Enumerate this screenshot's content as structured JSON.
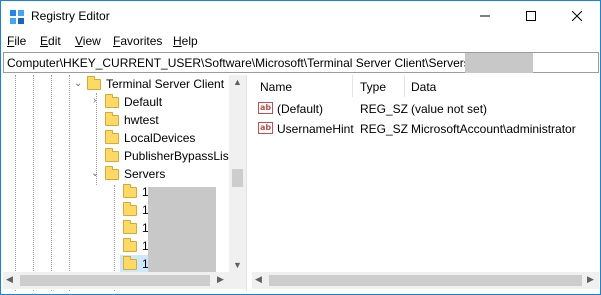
{
  "window": {
    "title": "Registry Editor",
    "icon": "registry-editor-icon"
  },
  "menu": [
    "File",
    "Edit",
    "View",
    "Favorites",
    "Help"
  ],
  "address": {
    "path": "Computer\\HKEY_CURRENT_USER\\Software\\Microsoft\\Terminal Server Client\\Servers\\"
  },
  "tree": {
    "items": [
      {
        "label": "Terminal Server Client",
        "expanded": true
      },
      {
        "label": "Default",
        "expanded": false
      },
      {
        "label": "hwtest"
      },
      {
        "label": "LocalDevices"
      },
      {
        "label": "PublisherBypassList"
      },
      {
        "label": "Servers",
        "expanded": true
      },
      {
        "label": "1"
      },
      {
        "label": "1"
      },
      {
        "label": "1"
      },
      {
        "label": "1"
      },
      {
        "label": "1",
        "selected": true
      }
    ]
  },
  "list": {
    "columns": [
      "Name",
      "Type",
      "Data"
    ],
    "rows": [
      {
        "name": "(Default)",
        "type": "REG_SZ",
        "data": "(value not set)",
        "icon": "string-value-icon"
      },
      {
        "name": "UsernameHint",
        "type": "REG_SZ",
        "data": "MicrosoftAccount\\administrator",
        "icon": "string-value-icon"
      }
    ]
  },
  "colors": {
    "accent": "#1883d7",
    "folder": "#ffd966",
    "selection": "#cce8ff",
    "redaction": "#c8c8c8"
  }
}
